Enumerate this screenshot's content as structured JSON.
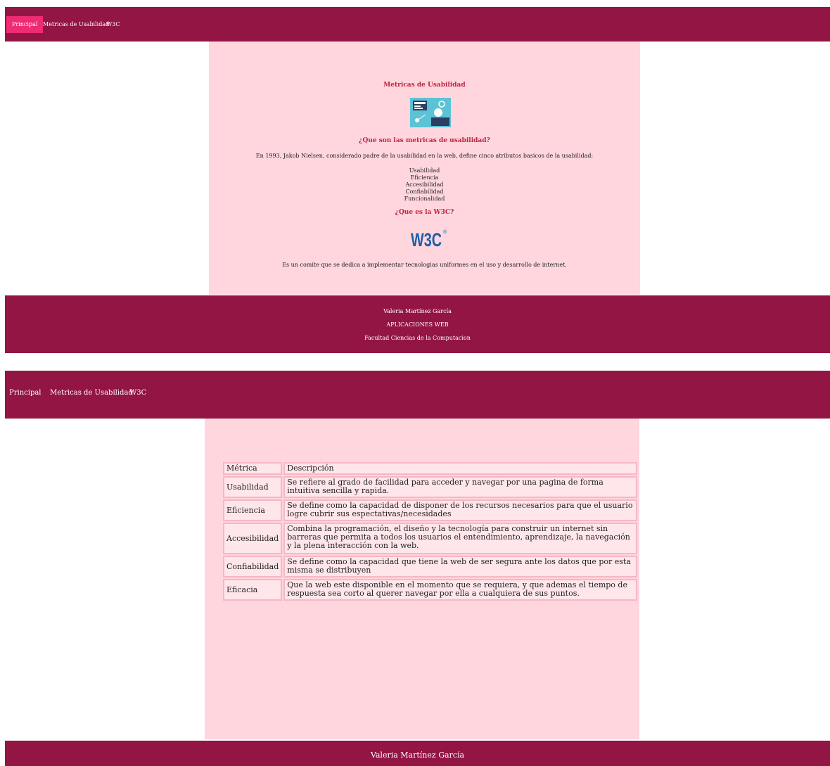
{
  "nav": {
    "items": [
      {
        "label": "Principal"
      },
      {
        "label": "Metricas de Usabilidad"
      },
      {
        "label": "W3C"
      }
    ],
    "active_color": "#ef2b74",
    "bar_color": "#921544"
  },
  "top_page": {
    "title": "Metricas de Usabilidad",
    "illustration_icon": "usability-illustration",
    "q1": "¿Que son las metricas de usabilidad?",
    "intro": "En 1993, Jakob Nielsen, considerado padre de la usabilidad en la web, define cinco atributos basicos de la usabilidad:",
    "attributes": [
      "Usabilidad",
      "Eficiencia",
      "Accesibilidad",
      "Confiabilidad",
      "Funcionalidad"
    ],
    "q2": "¿Que es la W3C?",
    "w3c_logo": "W3C",
    "w3c_mark": "®",
    "w3c_desc": "Es un comite que se dedica a implementar tecnologias uniformes en el uso y desarrollo de internet.",
    "background": "#ffd6de"
  },
  "footer": {
    "author": "Valeria Martínez García",
    "course": "APLICACIONES WEB",
    "faculty": "Facultad Ciencias de la Computacion"
  },
  "table": {
    "headers": [
      "Métrica",
      "Descripción"
    ],
    "rows": [
      {
        "metric": "Usabilidad",
        "desc": "Se refiere al grado de facilidad para acceder y navegar por una pagina de forma intuitiva sencilla y rapida."
      },
      {
        "metric": "Eficiencia",
        "desc": "Se define como la capacidad de disponer de los recursos necesarios para que el usuario logre cubrir sus espectativas/necesidades"
      },
      {
        "metric": "Accesibilidad",
        "desc": "Combina la programación, el diseño y la tecnología para construir un internet sin barreras que permita a todos los usuarios el entendimiento, aprendizaje, la navegación y la plena interacción con la web."
      },
      {
        "metric": "Confiabilidad",
        "desc": "Se define como la capacidad que tiene la web de ser segura ante los datos que por esta misma se distribuyen"
      },
      {
        "metric": "Eficacia",
        "desc": "Que la web este disponible en el momento que se requiera, y que ademas el tiempo de respuesta sea corto al querer navegar por ella a cualquiera de sus puntos."
      }
    ]
  }
}
